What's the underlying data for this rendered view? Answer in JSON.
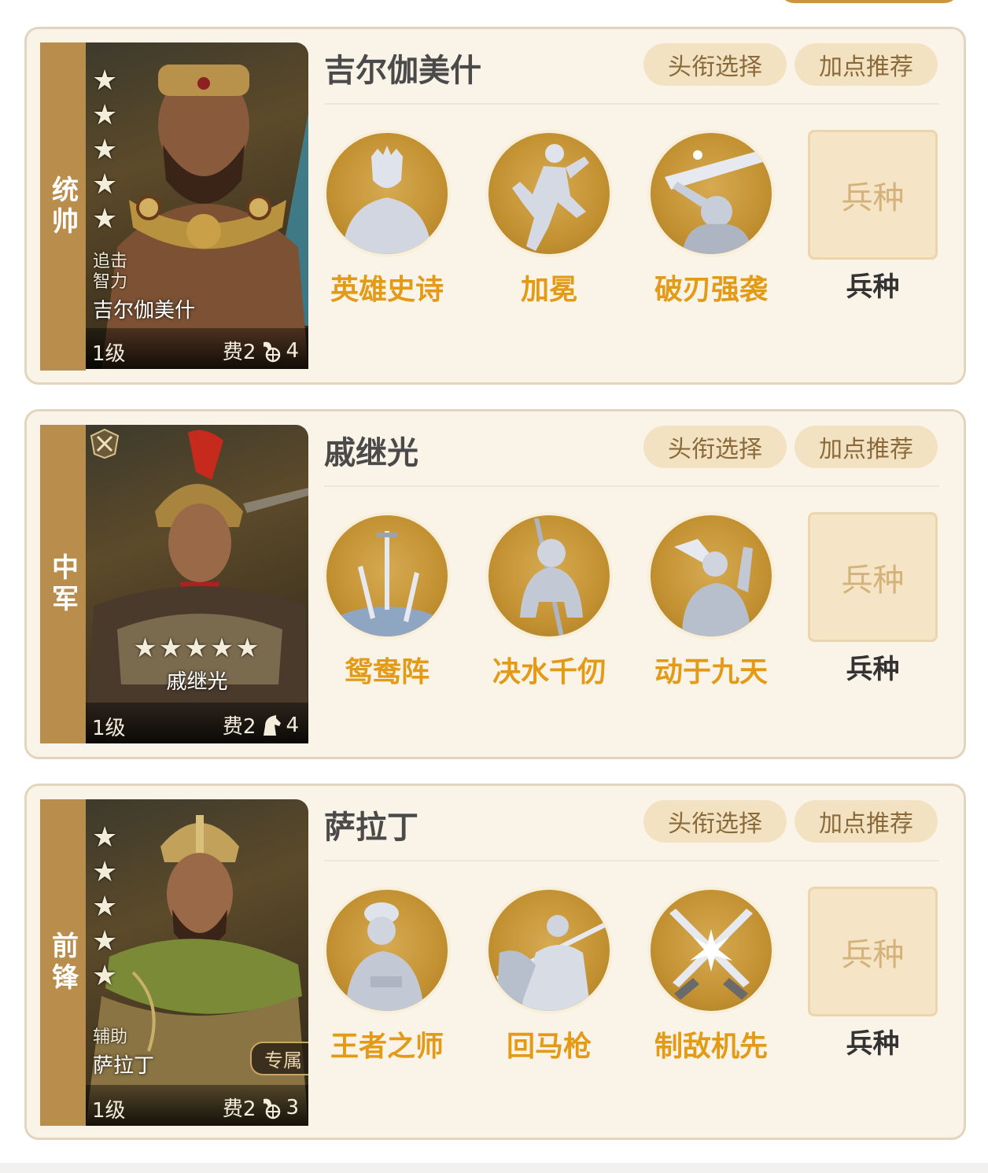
{
  "colors": {
    "accent": "#e39a16",
    "role_strip": "#b98d4c",
    "card_bg": "#faf4e8",
    "pill_bg": "#f3e2c2"
  },
  "cards": [
    {
      "role": "统帅",
      "hero_name": "吉尔伽美什",
      "title_btn": "头衔选择",
      "points_btn": "加点推荐",
      "portrait": {
        "tag1": "追击",
        "tag2": "智力",
        "name": "吉尔伽美什",
        "level": "1级",
        "cost": "费2",
        "troop": "4",
        "stars": 5
      },
      "skills": [
        {
          "name": "英雄史诗",
          "icon": "hero-bust-icon"
        },
        {
          "name": "加冕",
          "icon": "leaping-figure-icon"
        },
        {
          "name": "破刃强袭",
          "icon": "sword-strike-icon"
        }
      ],
      "troop_slot": "兵种",
      "troop_label": "兵种"
    },
    {
      "role": "中军",
      "hero_name": "戚继光",
      "title_btn": "头衔选择",
      "points_btn": "加点推荐",
      "portrait": {
        "name": "戚继光",
        "level": "1级",
        "cost": "费2",
        "troop": "4",
        "stars": 5
      },
      "skills": [
        {
          "name": "鸳鸯阵",
          "icon": "three-swords-icon"
        },
        {
          "name": "决水千仞",
          "icon": "kneeling-knight-icon"
        },
        {
          "name": "动于九天",
          "icon": "horn-blower-icon"
        }
      ],
      "troop_slot": "兵种",
      "troop_label": "兵种"
    },
    {
      "role": "前锋",
      "hero_name": "萨拉丁",
      "title_btn": "头衔选择",
      "points_btn": "加点推荐",
      "portrait": {
        "tag1": "辅助",
        "name": "萨拉丁",
        "level": "1级",
        "cost": "费2",
        "troop": "3",
        "stars": 5,
        "exclusive": "专属"
      },
      "skills": [
        {
          "name": "王者之师",
          "icon": "turbaned-king-icon"
        },
        {
          "name": "回马枪",
          "icon": "mounted-spearman-icon"
        },
        {
          "name": "制敌机先",
          "icon": "crossed-swords-icon"
        }
      ],
      "troop_slot": "兵种",
      "troop_label": "兵种"
    }
  ]
}
